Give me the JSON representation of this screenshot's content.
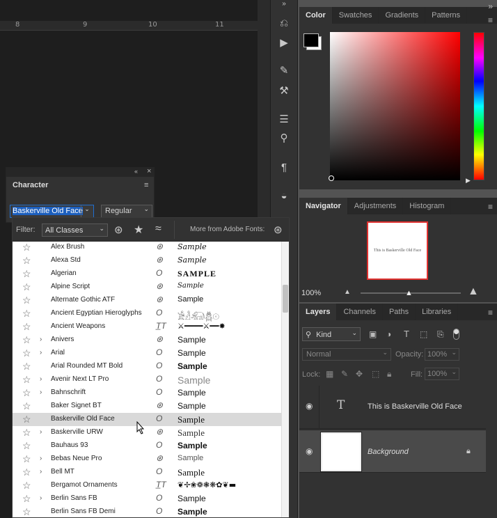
{
  "ruler": {
    "labels": [
      "8",
      "9",
      "10",
      "11"
    ]
  },
  "color_panel": {
    "tabs": [
      "Color",
      "Swatches",
      "Gradients",
      "Patterns"
    ],
    "foreground": "#000000",
    "background": "#ffffff"
  },
  "navigator": {
    "tabs": [
      "Navigator",
      "Adjustments",
      "Histogram"
    ],
    "thumb_text": "This is Baskerville Old Face",
    "zoom": "100%"
  },
  "layers": {
    "tabs": [
      "Layers",
      "Channels",
      "Paths",
      "Libraries"
    ],
    "kind_label": "Kind",
    "blend_mode": "Normal",
    "opacity_label": "Opacity:",
    "opacity_value": "100%",
    "lock_label": "Lock:",
    "fill_label": "Fill:",
    "fill_value": "100%",
    "items": [
      {
        "name": "This is Baskerville Old Face",
        "type": "text"
      },
      {
        "name": "Background",
        "type": "image"
      }
    ]
  },
  "character": {
    "title": "Character",
    "font_family": "Baskerville Old Face",
    "font_style": "Regular"
  },
  "font_filter": {
    "label": "Filter:",
    "classes": "All Classes",
    "more_label": "More from Adobe Fonts:"
  },
  "fonts": [
    {
      "name": "Alex Brush",
      "type": "cloud",
      "sample": "Sample",
      "expand": false
    },
    {
      "name": "Alexa Std",
      "type": "cloud",
      "sample": "Sample",
      "expand": false
    },
    {
      "name": "Algerian",
      "type": "otf",
      "sample": "SAMPLE",
      "expand": false
    },
    {
      "name": "Alpine Script",
      "type": "cloud",
      "sample": "Sample",
      "expand": false
    },
    {
      "name": "Alternate Gothic ATF",
      "type": "cloud",
      "sample": "Sample",
      "expand": false
    },
    {
      "name": "Ancient Egyptian Hieroglyphs",
      "type": "otf",
      "sample": "𓀀𓁐𓃰𓆣𓇳",
      "expand": false
    },
    {
      "name": "Ancient Weapons",
      "type": "ttf",
      "sample": "⚔━━━━⚔━━✸",
      "expand": false
    },
    {
      "name": "Anivers",
      "type": "cloud",
      "sample": "Sample",
      "expand": true
    },
    {
      "name": "Arial",
      "type": "otf",
      "sample": "Sample",
      "expand": true
    },
    {
      "name": "Arial Rounded MT Bold",
      "type": "otf",
      "sample": "Sample",
      "expand": false
    },
    {
      "name": "Avenir Next LT Pro",
      "type": "otf",
      "sample": "Sample",
      "expand": true
    },
    {
      "name": "Bahnschrift",
      "type": "var",
      "sample": "Sample",
      "expand": true
    },
    {
      "name": "Baker Signet BT",
      "type": "cloud",
      "sample": "Sample",
      "expand": false
    },
    {
      "name": "Baskerville Old Face",
      "type": "otf",
      "sample": "Sample",
      "expand": false,
      "selected": true
    },
    {
      "name": "Baskerville URW",
      "type": "cloud",
      "sample": "Sample",
      "expand": true
    },
    {
      "name": "Bauhaus 93",
      "type": "otf",
      "sample": "Sample",
      "expand": false
    },
    {
      "name": "Bebas Neue Pro",
      "type": "cloud",
      "sample": "Sample",
      "expand": true
    },
    {
      "name": "Bell MT",
      "type": "otf",
      "sample": "Sample",
      "expand": true
    },
    {
      "name": "Bergamot Ornaments",
      "type": "ttf",
      "sample": "❦✢❀❁❃❋✿❦▬",
      "expand": false
    },
    {
      "name": "Berlin Sans FB",
      "type": "otf",
      "sample": "Sample",
      "expand": true
    },
    {
      "name": "Berlin Sans FB Demi",
      "type": "otf",
      "sample": "Sample",
      "expand": false
    }
  ]
}
